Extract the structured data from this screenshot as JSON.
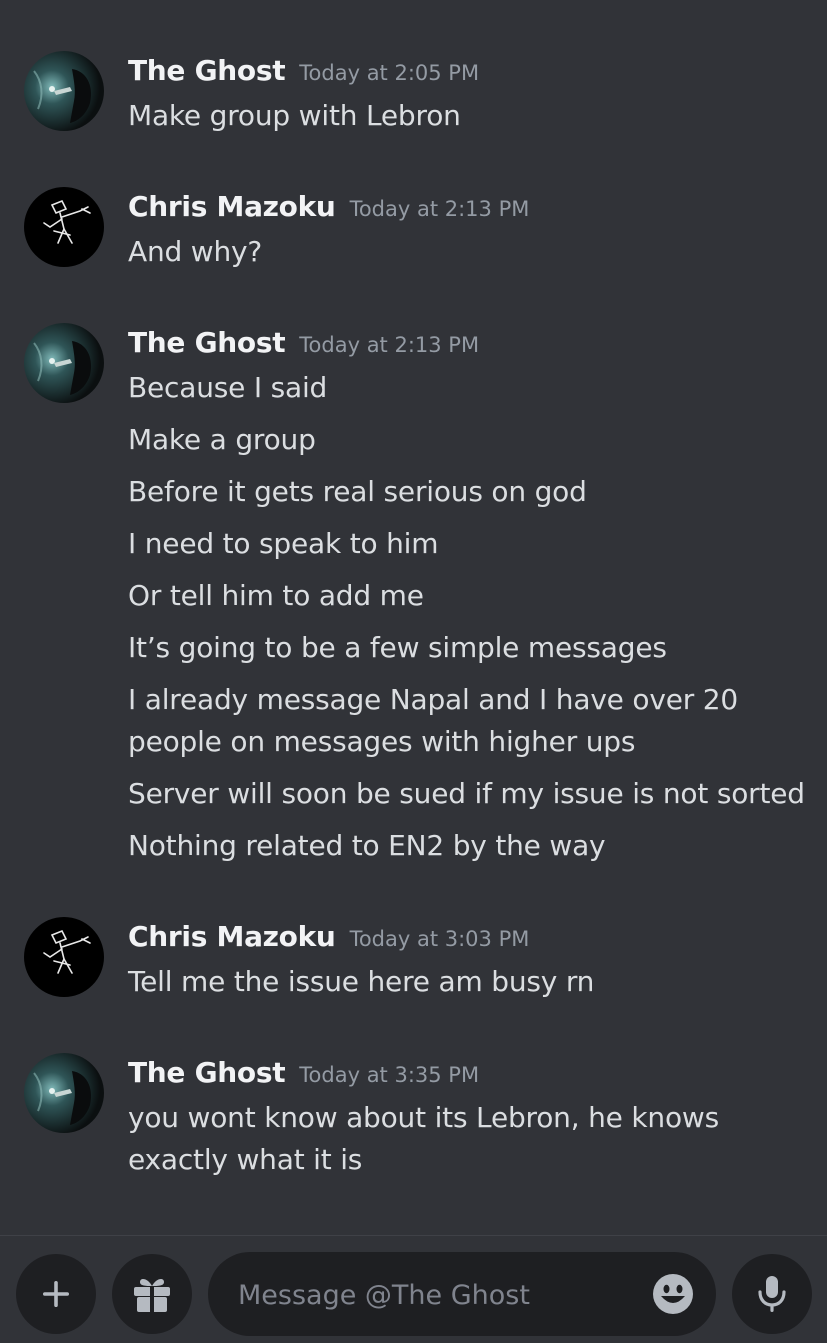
{
  "messages": [
    {
      "author": "The Ghost",
      "timestamp": "Today at 2:05 PM",
      "avatar": "the-ghost",
      "lines": [
        "Make group with Lebron"
      ]
    },
    {
      "author": "Chris Mazoku",
      "timestamp": "Today at 2:13 PM",
      "avatar": "chris-mazoku",
      "lines": [
        "And why?"
      ]
    },
    {
      "author": "The Ghost",
      "timestamp": "Today at 2:13 PM",
      "avatar": "the-ghost",
      "lines": [
        "Because I said",
        "Make a group",
        "Before it gets real serious on god",
        "I need to speak to him",
        "Or tell him to add me",
        "It’s going to be a few simple messages",
        "I already message Napal and I have over 20 people on messages with higher ups",
        "Server will soon be sued if my issue is not sorted",
        "Nothing related to EN2 by the way"
      ]
    },
    {
      "author": "Chris Mazoku",
      "timestamp": "Today at 3:03 PM",
      "avatar": "chris-mazoku",
      "lines": [
        "Tell me the issue here am busy rn"
      ]
    },
    {
      "author": "The Ghost",
      "timestamp": "Today at 3:35 PM",
      "avatar": "the-ghost",
      "lines": [
        "you wont know about its Lebron, he knows exactly what it is"
      ]
    }
  ],
  "composer": {
    "placeholder": "Message @The Ghost",
    "icons": [
      "plus-icon",
      "gift-icon",
      "emoji-icon",
      "microphone-icon"
    ]
  },
  "colors": {
    "background": "#313338",
    "input_background": "#1e1f22",
    "username": "#f2f3f5",
    "message_text": "#dbdee1",
    "timestamp": "#949ba4",
    "icon": "#b5bac1"
  }
}
